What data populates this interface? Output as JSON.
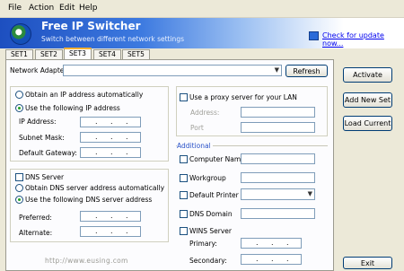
{
  "menu": {
    "file": "File",
    "action": "Action",
    "edit": "Edit",
    "help": "Help"
  },
  "header": {
    "title": "Free IP Switcher",
    "subtitle": "Switch between different network settings",
    "update_link": "Check for update now..."
  },
  "tabs": [
    "SET1",
    "SET2",
    "SET3",
    "SET4",
    "SET5"
  ],
  "active_tab": "SET3",
  "network_adapter": {
    "label": "Network Adapter:",
    "value": "",
    "refresh": "Refresh"
  },
  "ip": {
    "auto": "Obtain an IP address automatically",
    "manual": "Use the following IP address",
    "address": "IP Address:",
    "mask": "Subnet Mask:",
    "gateway": "Default Gateway:"
  },
  "dns": {
    "checkbox": "DNS Server",
    "auto": "Obtain DNS server address automatically",
    "manual": "Use the following DNS server address",
    "preferred": "Preferred:",
    "alternate": "Alternate:"
  },
  "proxy": {
    "checkbox": "Use a proxy server for your LAN",
    "address": "Address:",
    "port": "Port"
  },
  "additional": {
    "title": "Additional",
    "computer_name": "Computer Name",
    "workgroup": "Workgroup",
    "default_printer": "Default Printer",
    "dns_domain": "DNS Domain",
    "wins": "WINS Server",
    "primary": "Primary:",
    "secondary": "Secondary:"
  },
  "actions": {
    "activate": "Activate",
    "add_new": "Add New Set",
    "load_current": "Load Current",
    "exit": "Exit"
  },
  "watermark": "http://www.eusing.com",
  "colors": {
    "accent": "#1d4fc0",
    "link": "#0000ee",
    "additional": "#2a52c8"
  },
  "icons": [
    "app-logo-icon",
    "update-globe-icon",
    "combo-arrow-icon"
  ]
}
